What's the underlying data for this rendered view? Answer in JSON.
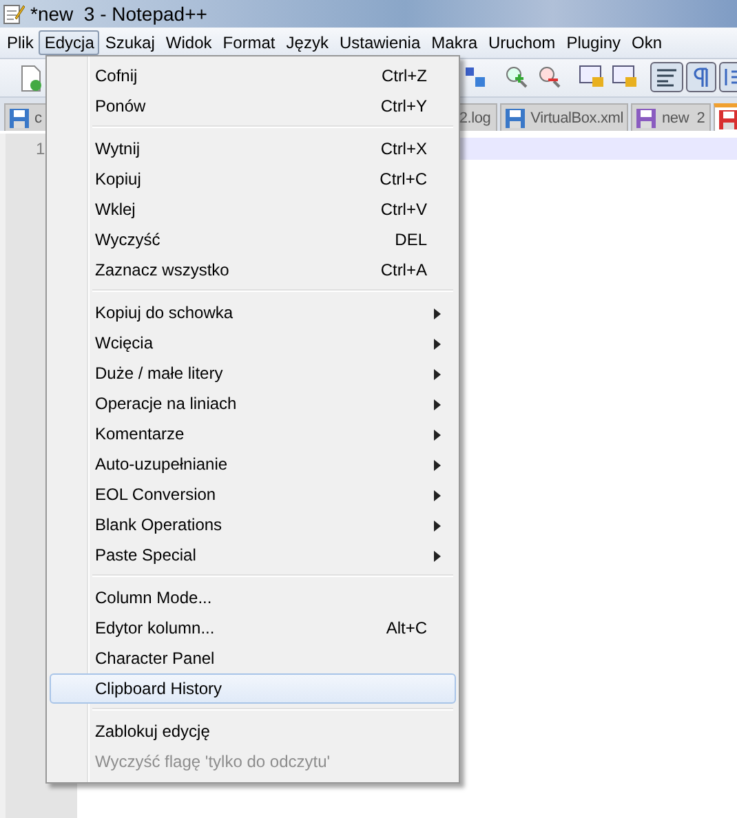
{
  "window": {
    "title": "*new  3 - Notepad++"
  },
  "menubar": [
    {
      "label": "Plik",
      "selected": false
    },
    {
      "label": "Edycja",
      "selected": true
    },
    {
      "label": "Szukaj",
      "selected": false
    },
    {
      "label": "Widok",
      "selected": false
    },
    {
      "label": "Format",
      "selected": false
    },
    {
      "label": "Język",
      "selected": false
    },
    {
      "label": "Ustawienia",
      "selected": false
    },
    {
      "label": "Makra",
      "selected": false
    },
    {
      "label": "Uruchom",
      "selected": false
    },
    {
      "label": "Pluginy",
      "selected": false
    },
    {
      "label": "Okn",
      "selected": false
    }
  ],
  "tabs": [
    {
      "label": "c",
      "color": "#3a78c8",
      "selected": false
    },
    {
      "label": "2.log",
      "selected": false
    },
    {
      "label": "VirtualBox.xml",
      "color": "#3a78c8",
      "selected": false
    },
    {
      "label": "new  2",
      "color": "#8a5cc0",
      "selected": false
    },
    {
      "color": "#d83030",
      "selected": true
    }
  ],
  "editor": {
    "line_numbers": [
      "1"
    ]
  },
  "menu": [
    {
      "kind": "item",
      "label": "Cofnij",
      "shortcut": "Ctrl+Z",
      "selected": false,
      "disabled": false
    },
    {
      "kind": "item",
      "label": "Ponów",
      "shortcut": "Ctrl+Y",
      "selected": false,
      "disabled": false
    },
    {
      "kind": "separator"
    },
    {
      "kind": "item",
      "label": "Wytnij",
      "shortcut": "Ctrl+X",
      "selected": false,
      "disabled": false
    },
    {
      "kind": "item",
      "label": "Kopiuj",
      "shortcut": "Ctrl+C",
      "selected": false,
      "disabled": false
    },
    {
      "kind": "item",
      "label": "Wklej",
      "shortcut": "Ctrl+V",
      "selected": false,
      "disabled": false
    },
    {
      "kind": "item",
      "label": "Wyczyść",
      "shortcut": "DEL",
      "selected": false,
      "disabled": false
    },
    {
      "kind": "item",
      "label": "Zaznacz wszystko",
      "shortcut": "Ctrl+A",
      "selected": false,
      "disabled": false
    },
    {
      "kind": "separator"
    },
    {
      "kind": "submenu",
      "label": "Kopiuj do schowka",
      "selected": false,
      "disabled": false
    },
    {
      "kind": "submenu",
      "label": "Wcięcia",
      "selected": false,
      "disabled": false
    },
    {
      "kind": "submenu",
      "label": "Duże / małe litery",
      "selected": false,
      "disabled": false
    },
    {
      "kind": "submenu",
      "label": "Operacje na liniach",
      "selected": false,
      "disabled": false
    },
    {
      "kind": "submenu",
      "label": "Komentarze",
      "selected": false,
      "disabled": false
    },
    {
      "kind": "submenu",
      "label": "Auto-uzupełnianie",
      "selected": false,
      "disabled": false
    },
    {
      "kind": "submenu",
      "label": "EOL Conversion",
      "selected": false,
      "disabled": false
    },
    {
      "kind": "submenu",
      "label": "Blank Operations",
      "selected": false,
      "disabled": false
    },
    {
      "kind": "submenu",
      "label": "Paste Special",
      "selected": false,
      "disabled": false
    },
    {
      "kind": "separator"
    },
    {
      "kind": "item",
      "label": "Column Mode...",
      "selected": false,
      "disabled": false
    },
    {
      "kind": "item",
      "label": "Edytor kolumn...",
      "shortcut": "Alt+C",
      "selected": false,
      "disabled": false
    },
    {
      "kind": "item",
      "label": "Character Panel",
      "selected": false,
      "disabled": false
    },
    {
      "kind": "item",
      "label": "Clipboard History",
      "selected": true,
      "disabled": false
    },
    {
      "kind": "separator"
    },
    {
      "kind": "item",
      "label": "Zablokuj edycję",
      "selected": false,
      "disabled": false
    },
    {
      "kind": "item",
      "label": "Wyczyść flagę 'tylko do odczytu'",
      "selected": false,
      "disabled": true
    }
  ]
}
